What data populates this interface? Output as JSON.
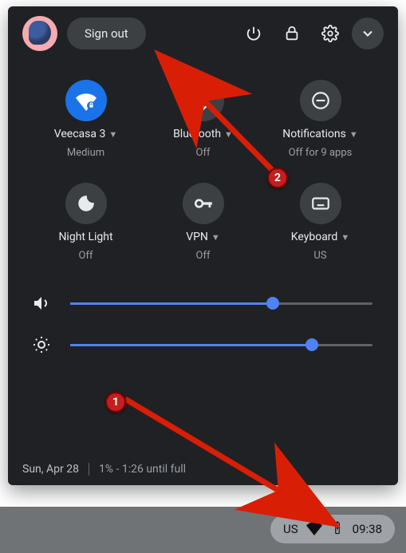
{
  "header": {
    "signout_label": "Sign out"
  },
  "tiles": {
    "wifi": {
      "label": "Veecasa 3",
      "sub": "Medium",
      "has_caret": true
    },
    "bluetooth": {
      "label": "Bluetooth",
      "sub": "Off",
      "has_caret": true
    },
    "notifications": {
      "label": "Notifications",
      "sub": "Off for 9 apps",
      "has_caret": true
    },
    "nightlight": {
      "label": "Night Light",
      "sub": "Off",
      "has_caret": false
    },
    "vpn": {
      "label": "VPN",
      "sub": "Off",
      "has_caret": true
    },
    "keyboard": {
      "label": "Keyboard",
      "sub": "US",
      "has_caret": true
    }
  },
  "sliders": {
    "volume_pct": 67,
    "brightness_pct": 80
  },
  "footer": {
    "date": "Sun, Apr 28",
    "battery_text": "1% - 1:26 until full"
  },
  "tray": {
    "ime": "US",
    "time": "09:38"
  },
  "annotations": {
    "badge1": "1",
    "badge2": "2"
  },
  "colors": {
    "accent": "#4f82f6",
    "panel_bg": "#202124",
    "button_bg": "#3c4043"
  }
}
